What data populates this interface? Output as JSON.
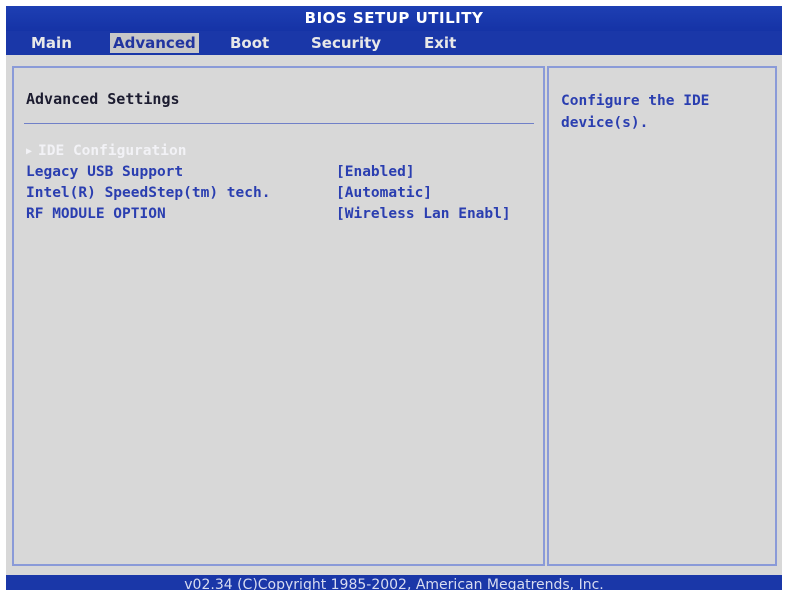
{
  "title": "BIOS SETUP UTILITY",
  "menu": {
    "items": [
      {
        "label": "Main"
      },
      {
        "label": "Advanced",
        "active": true
      },
      {
        "label": "Boot"
      },
      {
        "label": "Security"
      },
      {
        "label": "Exit"
      }
    ]
  },
  "main": {
    "section_title": "Advanced Settings",
    "rows": [
      {
        "label": "IDE Configuration",
        "value": "",
        "submenu_icon": "triangle-right-icon",
        "selected": true
      },
      {
        "label": "Legacy USB Support",
        "value": "[Enabled]"
      },
      {
        "label": "Intel(R) SpeedStep(tm) tech.",
        "value": "[Automatic]"
      },
      {
        "label": "RF MODULE OPTION",
        "value": "[Wireless Lan Enabl]"
      }
    ]
  },
  "help": {
    "text": "Configure the IDE device(s)."
  },
  "footer": {
    "text": "v02.34 (C)Copyright 1985-2002, American Megatrends, Inc."
  },
  "colors": {
    "bar_blue": "#1a37a8",
    "panel_gray": "#d8d8d8",
    "text_blue": "#2a3eb0",
    "selected_text": "#f2f2f6"
  }
}
